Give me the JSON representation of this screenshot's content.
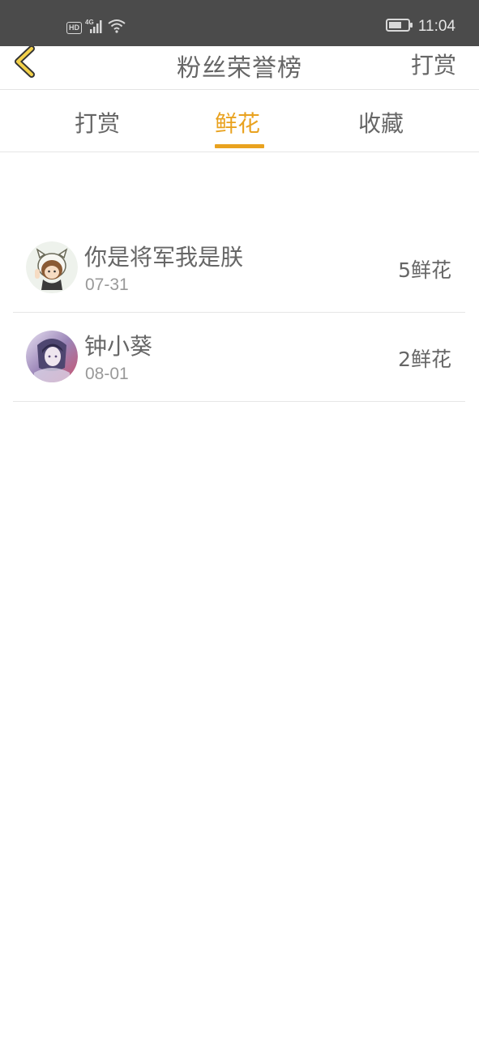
{
  "status_bar": {
    "hd_badge": "HD",
    "network": "4G",
    "time": "11:04",
    "icons": [
      "hd-icon",
      "cellular-signal-icon",
      "wifi-icon",
      "battery-icon"
    ]
  },
  "app_bar": {
    "back_icon": "chevron-left-icon",
    "title": "粉丝荣誉榜",
    "action_label": "打赏"
  },
  "tabs": [
    {
      "label": "打赏",
      "active": false
    },
    {
      "label": "鲜花",
      "active": true
    },
    {
      "label": "收藏",
      "active": false
    }
  ],
  "list": [
    {
      "name": "你是将军我是朕",
      "date": "07-31",
      "amount": "5鲜花",
      "avatar": "avatar-image"
    },
    {
      "name": "钟小葵",
      "date": "08-01",
      "amount": "2鲜花",
      "avatar": "avatar-image"
    }
  ],
  "colors": {
    "accent": "#e9a21f",
    "status_bar": "#4b4b4b",
    "text": "#666666",
    "subtext": "#999999"
  }
}
